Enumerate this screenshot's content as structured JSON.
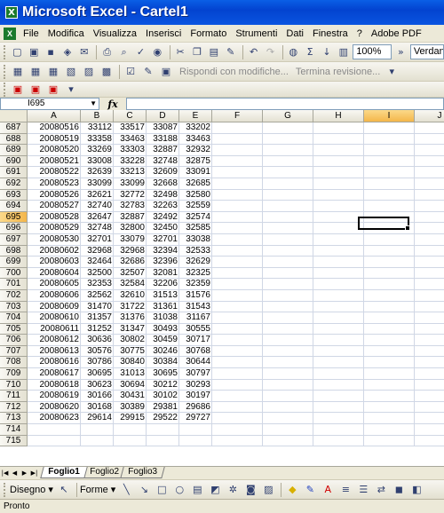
{
  "window": {
    "title": "Microsoft Excel - Cartel1",
    "app_icon_letter": "X"
  },
  "menubar": {
    "items": [
      "File",
      "Modifica",
      "Visualizza",
      "Inserisci",
      "Formato",
      "Strumenti",
      "Dati",
      "Finestra",
      "?",
      "Adobe PDF"
    ]
  },
  "toolbar": {
    "zoom": "100%",
    "font": "Verdan",
    "reply_with_changes": "Rispondi con modifiche...",
    "end_review": "Termina revisione..."
  },
  "formula_bar": {
    "name_box": "I695",
    "fx_label": "fx",
    "content": ""
  },
  "grid": {
    "columns": [
      "A",
      "B",
      "C",
      "D",
      "E",
      "F",
      "G",
      "H",
      "I",
      "J"
    ],
    "selected_column": "I",
    "selected_row": "695",
    "rows": [
      {
        "n": "687",
        "cells": [
          "20080516",
          "33112",
          "33517",
          "33087",
          "33202"
        ]
      },
      {
        "n": "688",
        "cells": [
          "20080519",
          "33358",
          "33463",
          "33188",
          "33463"
        ]
      },
      {
        "n": "689",
        "cells": [
          "20080520",
          "33269",
          "33303",
          "32887",
          "32932"
        ]
      },
      {
        "n": "690",
        "cells": [
          "20080521",
          "33008",
          "33228",
          "32748",
          "32875"
        ]
      },
      {
        "n": "691",
        "cells": [
          "20080522",
          "32639",
          "33213",
          "32609",
          "33091"
        ]
      },
      {
        "n": "692",
        "cells": [
          "20080523",
          "33099",
          "33099",
          "32668",
          "32685"
        ]
      },
      {
        "n": "693",
        "cells": [
          "20080526",
          "32621",
          "32772",
          "32498",
          "32580"
        ]
      },
      {
        "n": "694",
        "cells": [
          "20080527",
          "32740",
          "32783",
          "32263",
          "32559"
        ]
      },
      {
        "n": "695",
        "cells": [
          "20080528",
          "32647",
          "32887",
          "32492",
          "32574"
        ]
      },
      {
        "n": "696",
        "cells": [
          "20080529",
          "32748",
          "32800",
          "32450",
          "32585"
        ]
      },
      {
        "n": "697",
        "cells": [
          "20080530",
          "32701",
          "33079",
          "32701",
          "33038"
        ]
      },
      {
        "n": "698",
        "cells": [
          "20080602",
          "32968",
          "32968",
          "32394",
          "32533"
        ]
      },
      {
        "n": "699",
        "cells": [
          "20080603",
          "32464",
          "32686",
          "32396",
          "32629"
        ]
      },
      {
        "n": "700",
        "cells": [
          "20080604",
          "32500",
          "32507",
          "32081",
          "32325"
        ]
      },
      {
        "n": "701",
        "cells": [
          "20080605",
          "32353",
          "32584",
          "32206",
          "32359"
        ]
      },
      {
        "n": "702",
        "cells": [
          "20080606",
          "32562",
          "32610",
          "31513",
          "31576"
        ]
      },
      {
        "n": "703",
        "cells": [
          "20080609",
          "31470",
          "31722",
          "31361",
          "31543"
        ]
      },
      {
        "n": "704",
        "cells": [
          "20080610",
          "31357",
          "31376",
          "31038",
          "31167"
        ]
      },
      {
        "n": "705",
        "cells": [
          "20080611",
          "31252",
          "31347",
          "30493",
          "30555"
        ]
      },
      {
        "n": "706",
        "cells": [
          "20080612",
          "30636",
          "30802",
          "30459",
          "30717"
        ]
      },
      {
        "n": "707",
        "cells": [
          "20080613",
          "30576",
          "30775",
          "30246",
          "30768"
        ]
      },
      {
        "n": "708",
        "cells": [
          "20080616",
          "30786",
          "30840",
          "30384",
          "30644"
        ]
      },
      {
        "n": "709",
        "cells": [
          "20080617",
          "30695",
          "31013",
          "30695",
          "30797"
        ]
      },
      {
        "n": "710",
        "cells": [
          "20080618",
          "30623",
          "30694",
          "30212",
          "30293"
        ]
      },
      {
        "n": "711",
        "cells": [
          "20080619",
          "30166",
          "30431",
          "30102",
          "30197"
        ]
      },
      {
        "n": "712",
        "cells": [
          "20080620",
          "30168",
          "30389",
          "29381",
          "29686"
        ]
      },
      {
        "n": "713",
        "cells": [
          "20080623",
          "29614",
          "29915",
          "29522",
          "29727"
        ]
      },
      {
        "n": "714",
        "cells": []
      },
      {
        "n": "715",
        "cells": []
      }
    ]
  },
  "sheets": {
    "tabs": [
      "Foglio1",
      "Foglio2",
      "Foglio3"
    ],
    "active": "Foglio1"
  },
  "drawing": {
    "draw_label": "Disegno",
    "shapes_label": "Forme"
  },
  "status": {
    "text": "Pronto"
  }
}
